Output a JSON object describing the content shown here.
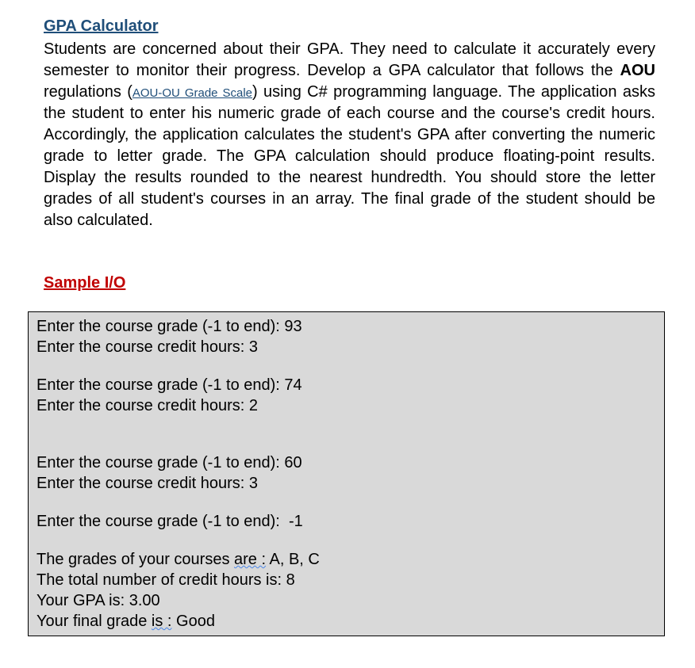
{
  "title": "GPA Calculator",
  "description": {
    "part1": "Students are concerned about their GPA. They need to calculate it accurately every semester to monitor their progress. Develop a GPA calculator that follows the ",
    "bold1": "AOU",
    "part2": " regulations (",
    "link": "AOU-OU Grade Scale",
    "part3": ") using C# programming language. The application asks the student to enter his numeric grade of each course and the course's credit hours. Accordingly, the application calculates the student's GPA after converting the numeric grade to letter grade. The GPA calculation should produce floating-point results. Display the results rounded to the nearest hundredth. You should store the letter grades of all student's courses in an array. The final grade of the student should be also calculated."
  },
  "sample_heading": "Sample I/O",
  "io": {
    "line1": "Enter the course grade (-1 to end): 93",
    "line2": "Enter the course credit hours: 3",
    "line3": "Enter the course grade (-1 to end): 74",
    "line4": "Enter the course credit hours: 2",
    "line5": "Enter the course grade (-1 to end): 60",
    "line6": "Enter the course credit hours: 3",
    "line7": "Enter the course grade (-1 to end):  -1",
    "line8a": "The grades of your courses ",
    "line8b": "are :",
    "line8c": " A, B, C",
    "line9": "The total number of credit hours is: 8",
    "line10": "Your GPA is: 3.00",
    "line11a": "Your final grade ",
    "line11b": "is :",
    "line11c": " Good"
  }
}
